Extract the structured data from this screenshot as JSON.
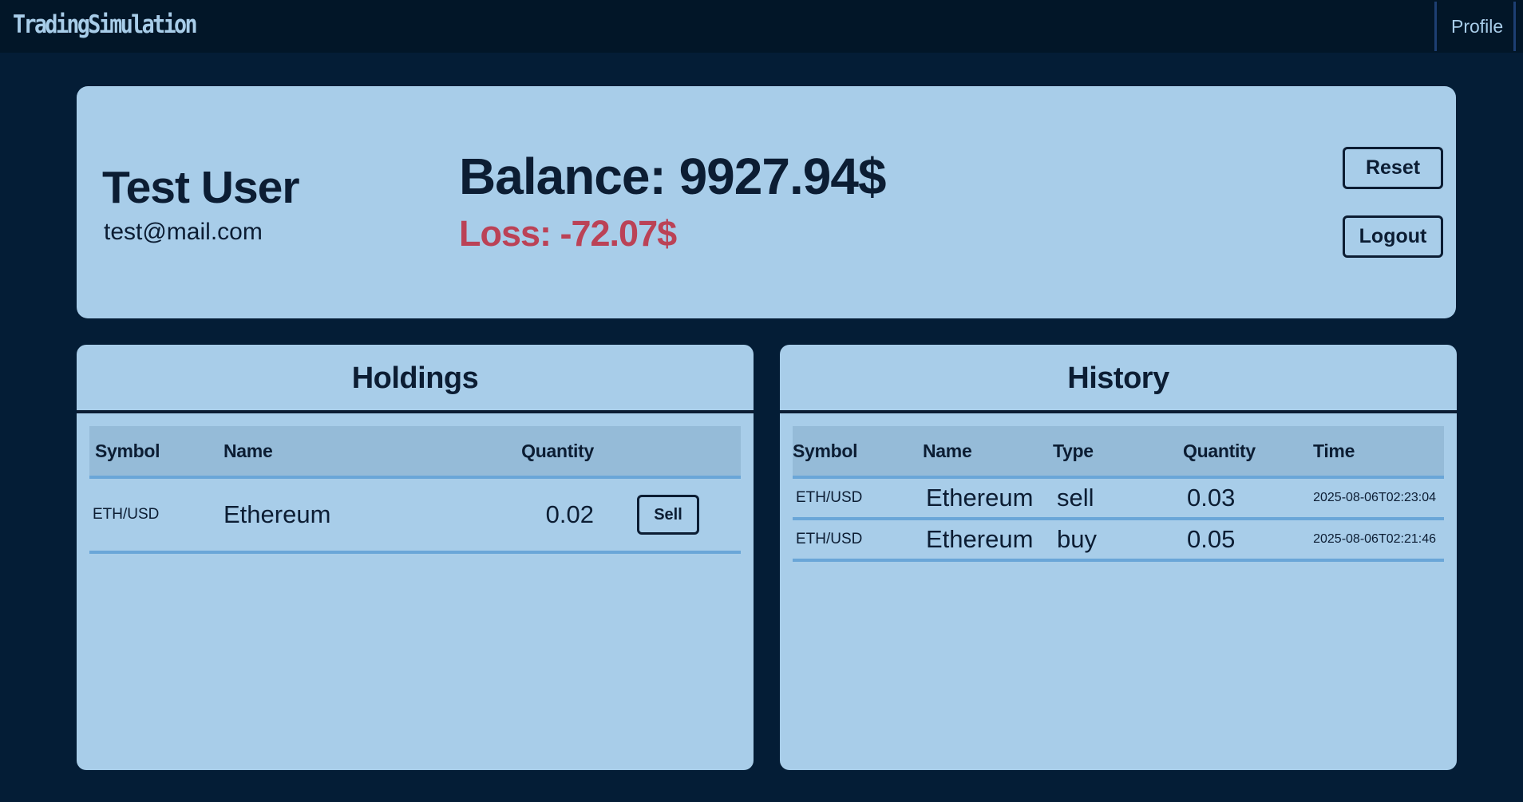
{
  "navbar": {
    "brand": "TradingSimulation",
    "profile_link": "Profile"
  },
  "profile": {
    "name": "Test User",
    "email": "test@mail.com",
    "balance_text": "Balance: 9927.94$",
    "pnl_text": "Loss: -72.07$",
    "reset_label": "Reset",
    "logout_label": "Logout"
  },
  "holdings": {
    "title": "Holdings",
    "columns": [
      "Symbol",
      "Name",
      "Quantity"
    ],
    "rows": [
      {
        "symbol": "ETH/USD",
        "name": "Ethereum",
        "quantity": "0.02",
        "action_label": "Sell"
      }
    ]
  },
  "history": {
    "title": "History",
    "columns": [
      "Symbol",
      "Name",
      "Type",
      "Quantity",
      "Time"
    ],
    "rows": [
      {
        "symbol": "ETH/USD",
        "name": "Ethereum",
        "type": "sell",
        "quantity": "0.03",
        "time": "2025-08-06T02:23:04"
      },
      {
        "symbol": "ETH/USD",
        "name": "Ethereum",
        "type": "buy",
        "quantity": "0.05",
        "time": "2025-08-06T02:21:46"
      }
    ]
  },
  "colors": {
    "page_background": "#041d36",
    "navbar_background": "#021628",
    "card_background": "#a8cde9",
    "text_dark": "#0c1d33",
    "loss": "#bb4256",
    "table_header": "#95bbd8",
    "row_divider": "#6aa6d8"
  }
}
